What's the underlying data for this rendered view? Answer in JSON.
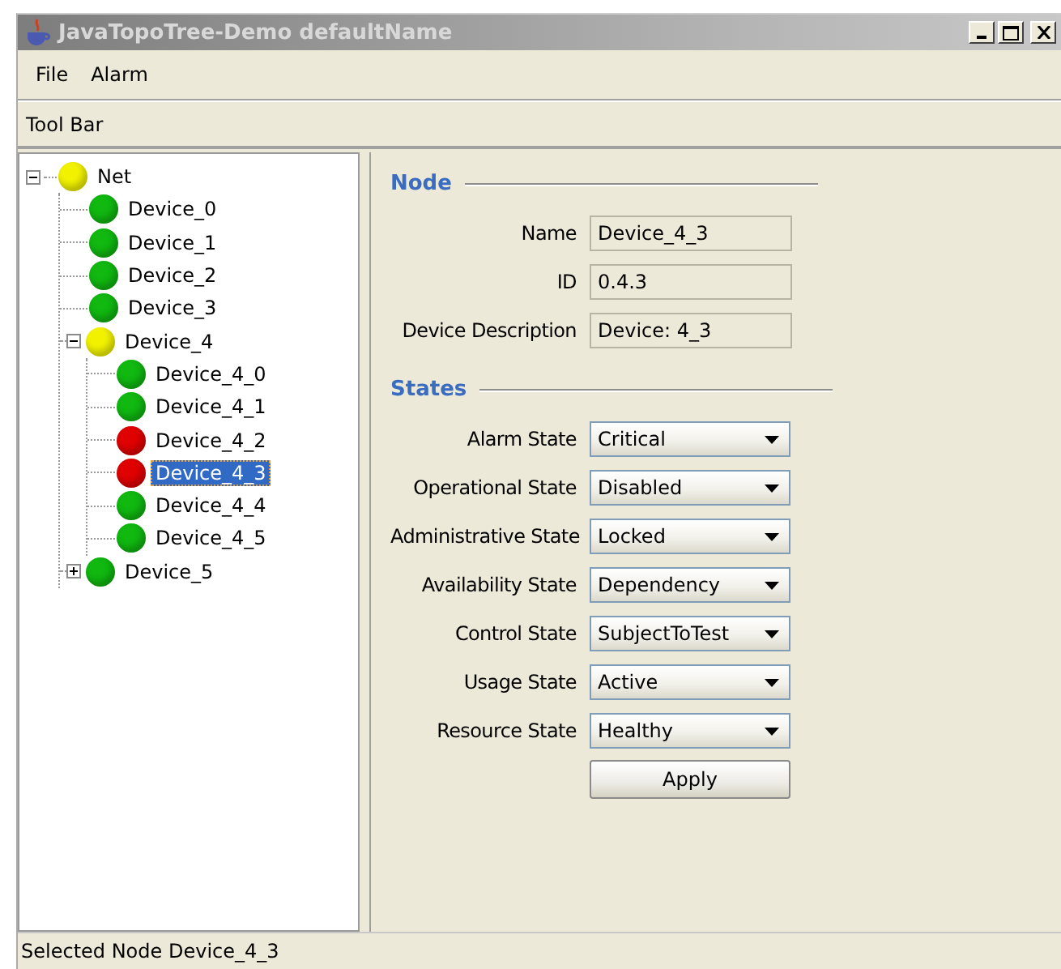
{
  "window": {
    "title": "JavaTopoTree-Demo defaultName"
  },
  "menu": [
    "File",
    "Alarm"
  ],
  "toolbar": {
    "label": "Tool Bar"
  },
  "tree": [
    {
      "label": "Net",
      "color": "#f2f200",
      "expanded": true,
      "selected": false,
      "children": [
        {
          "label": "Device_0",
          "color": "#10b810",
          "selected": false
        },
        {
          "label": "Device_1",
          "color": "#10b810",
          "selected": false
        },
        {
          "label": "Device_2",
          "color": "#10b810",
          "selected": false
        },
        {
          "label": "Device_3",
          "color": "#10b810",
          "selected": false
        },
        {
          "label": "Device_4",
          "color": "#f2f200",
          "expanded": true,
          "selected": false,
          "children": [
            {
              "label": "Device_4_0",
              "color": "#10b810",
              "selected": false
            },
            {
              "label": "Device_4_1",
              "color": "#10b810",
              "selected": false
            },
            {
              "label": "Device_4_2",
              "color": "#e00000",
              "selected": false
            },
            {
              "label": "Device_4_3",
              "color": "#e00000",
              "selected": true
            },
            {
              "label": "Device_4_4",
              "color": "#10b810",
              "selected": false
            },
            {
              "label": "Device_4_5",
              "color": "#10b810",
              "selected": false
            }
          ]
        },
        {
          "label": "Device_5",
          "color": "#10b810",
          "expanded": false,
          "selected": false
        }
      ]
    }
  ],
  "sections": [
    {
      "title": "Node",
      "rows": [
        {
          "kind": "text",
          "label": "Name",
          "value": "Device_4_3"
        },
        {
          "kind": "text",
          "label": "ID",
          "value": "0.4.3"
        },
        {
          "kind": "text",
          "label": "Device Description",
          "value": "Device: 4_3"
        }
      ]
    },
    {
      "title": "States",
      "rows": [
        {
          "kind": "select",
          "label": "Alarm State",
          "value": "Critical"
        },
        {
          "kind": "select",
          "label": "Operational State",
          "value": "Disabled"
        },
        {
          "kind": "select",
          "label": "Administrative State",
          "value": "Locked"
        },
        {
          "kind": "select",
          "label": "Availability State",
          "value": "Dependency"
        },
        {
          "kind": "select",
          "label": "Control State",
          "value": "SubjectToTest"
        },
        {
          "kind": "select",
          "label": "Usage State",
          "value": "Active"
        },
        {
          "kind": "select",
          "label": "Resource State",
          "value": "Healthy"
        }
      ]
    }
  ],
  "apply_button": "Apply",
  "status_bar": "Selected Node Device_4_3"
}
